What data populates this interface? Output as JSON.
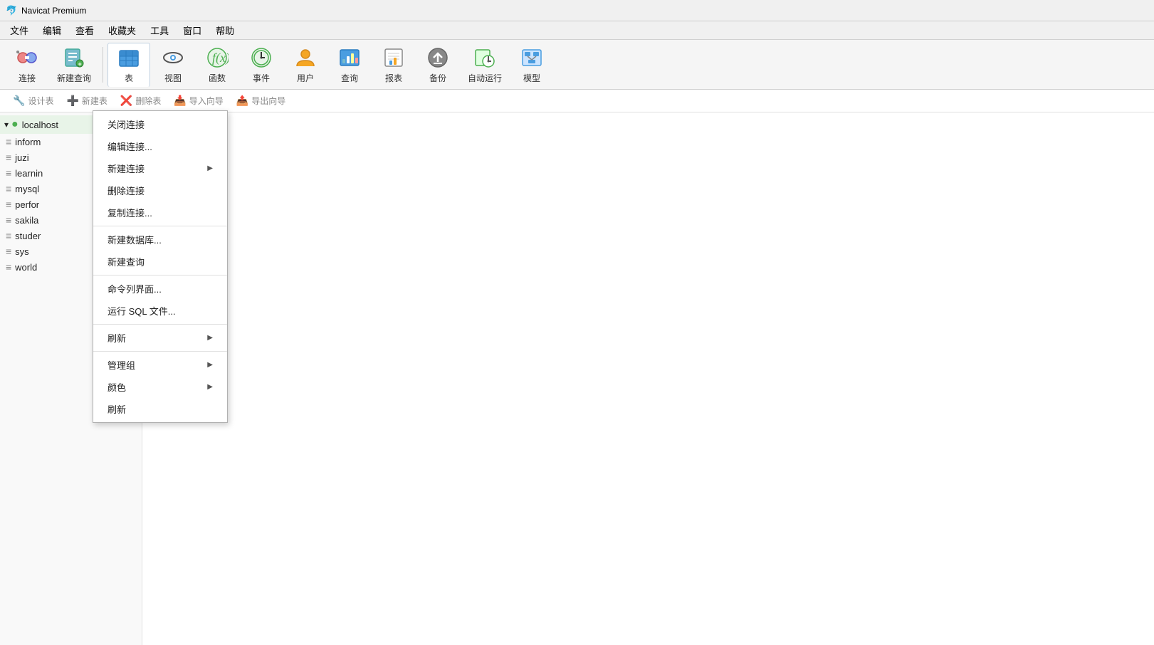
{
  "titleBar": {
    "appName": "Navicat Premium"
  },
  "menuBar": {
    "items": [
      "文件",
      "编辑",
      "查看",
      "收藏夹",
      "工具",
      "窗口",
      "帮助"
    ]
  },
  "toolbar": {
    "buttons": [
      {
        "id": "connect",
        "label": "连接",
        "icon": "🔌"
      },
      {
        "id": "new-query",
        "label": "新建查询",
        "icon": "📋"
      },
      {
        "id": "table",
        "label": "表",
        "icon": "🗃️",
        "active": true
      },
      {
        "id": "view",
        "label": "视图",
        "icon": "👓"
      },
      {
        "id": "function",
        "label": "函数",
        "icon": "𝑓"
      },
      {
        "id": "event",
        "label": "事件",
        "icon": "⏰"
      },
      {
        "id": "user",
        "label": "用户",
        "icon": "👤"
      },
      {
        "id": "query",
        "label": "查询",
        "icon": "📊"
      },
      {
        "id": "report",
        "label": "报表",
        "icon": "📈"
      },
      {
        "id": "backup",
        "label": "备份",
        "icon": "💾"
      },
      {
        "id": "autorun",
        "label": "自动运行",
        "icon": "⏱️"
      },
      {
        "id": "model",
        "label": "模型",
        "icon": "🗂️"
      }
    ]
  },
  "subToolbar": {
    "buttons": [
      {
        "id": "design-table",
        "label": "设计表",
        "icon": "🔧"
      },
      {
        "id": "new-table",
        "label": "新建表",
        "icon": "➕"
      },
      {
        "id": "delete-table",
        "label": "删除表",
        "icon": "❌"
      },
      {
        "id": "import-wizard",
        "label": "导入向导",
        "icon": "📥"
      },
      {
        "id": "export-wizard",
        "label": "导出向导",
        "icon": "📤"
      }
    ]
  },
  "sidebar": {
    "connection": {
      "label": "localhost",
      "icon": "🔗"
    },
    "databases": [
      {
        "label": "inform",
        "icon": "🗄️"
      },
      {
        "label": "juzi",
        "icon": "🗄️"
      },
      {
        "label": "learnin",
        "icon": "🗄️"
      },
      {
        "label": "mysql",
        "icon": "🗄️"
      },
      {
        "label": "perfor",
        "icon": "🗄️"
      },
      {
        "label": "sakila",
        "icon": "🗄️"
      },
      {
        "label": "studer",
        "icon": "🗄️"
      },
      {
        "label": "sys",
        "icon": "🗄️"
      },
      {
        "label": "world",
        "icon": "🗄️"
      }
    ]
  },
  "contextMenu": {
    "items": [
      {
        "id": "close-conn",
        "label": "关闭连接",
        "hasArrow": false
      },
      {
        "id": "edit-conn",
        "label": "编辑连接...",
        "hasArrow": false
      },
      {
        "id": "new-conn",
        "label": "新建连接",
        "hasArrow": true
      },
      {
        "id": "delete-conn",
        "label": "删除连接",
        "hasArrow": false
      },
      {
        "id": "copy-conn",
        "label": "复制连接...",
        "hasArrow": false
      },
      {
        "separator": true
      },
      {
        "id": "new-db",
        "label": "新建数据库...",
        "hasArrow": false
      },
      {
        "id": "new-query2",
        "label": "新建查询",
        "hasArrow": false
      },
      {
        "separator": true
      },
      {
        "id": "cmd-line",
        "label": "命令列界面...",
        "hasArrow": false
      },
      {
        "id": "run-sql",
        "label": "运行 SQL 文件...",
        "hasArrow": false
      },
      {
        "separator": true
      },
      {
        "id": "refresh",
        "label": "刷新",
        "hasArrow": true
      },
      {
        "separator": true
      },
      {
        "id": "manage-group",
        "label": "管理组",
        "hasArrow": true
      },
      {
        "id": "color",
        "label": "颜色",
        "hasArrow": true
      },
      {
        "id": "refresh2",
        "label": "刷新",
        "hasArrow": false
      }
    ]
  }
}
